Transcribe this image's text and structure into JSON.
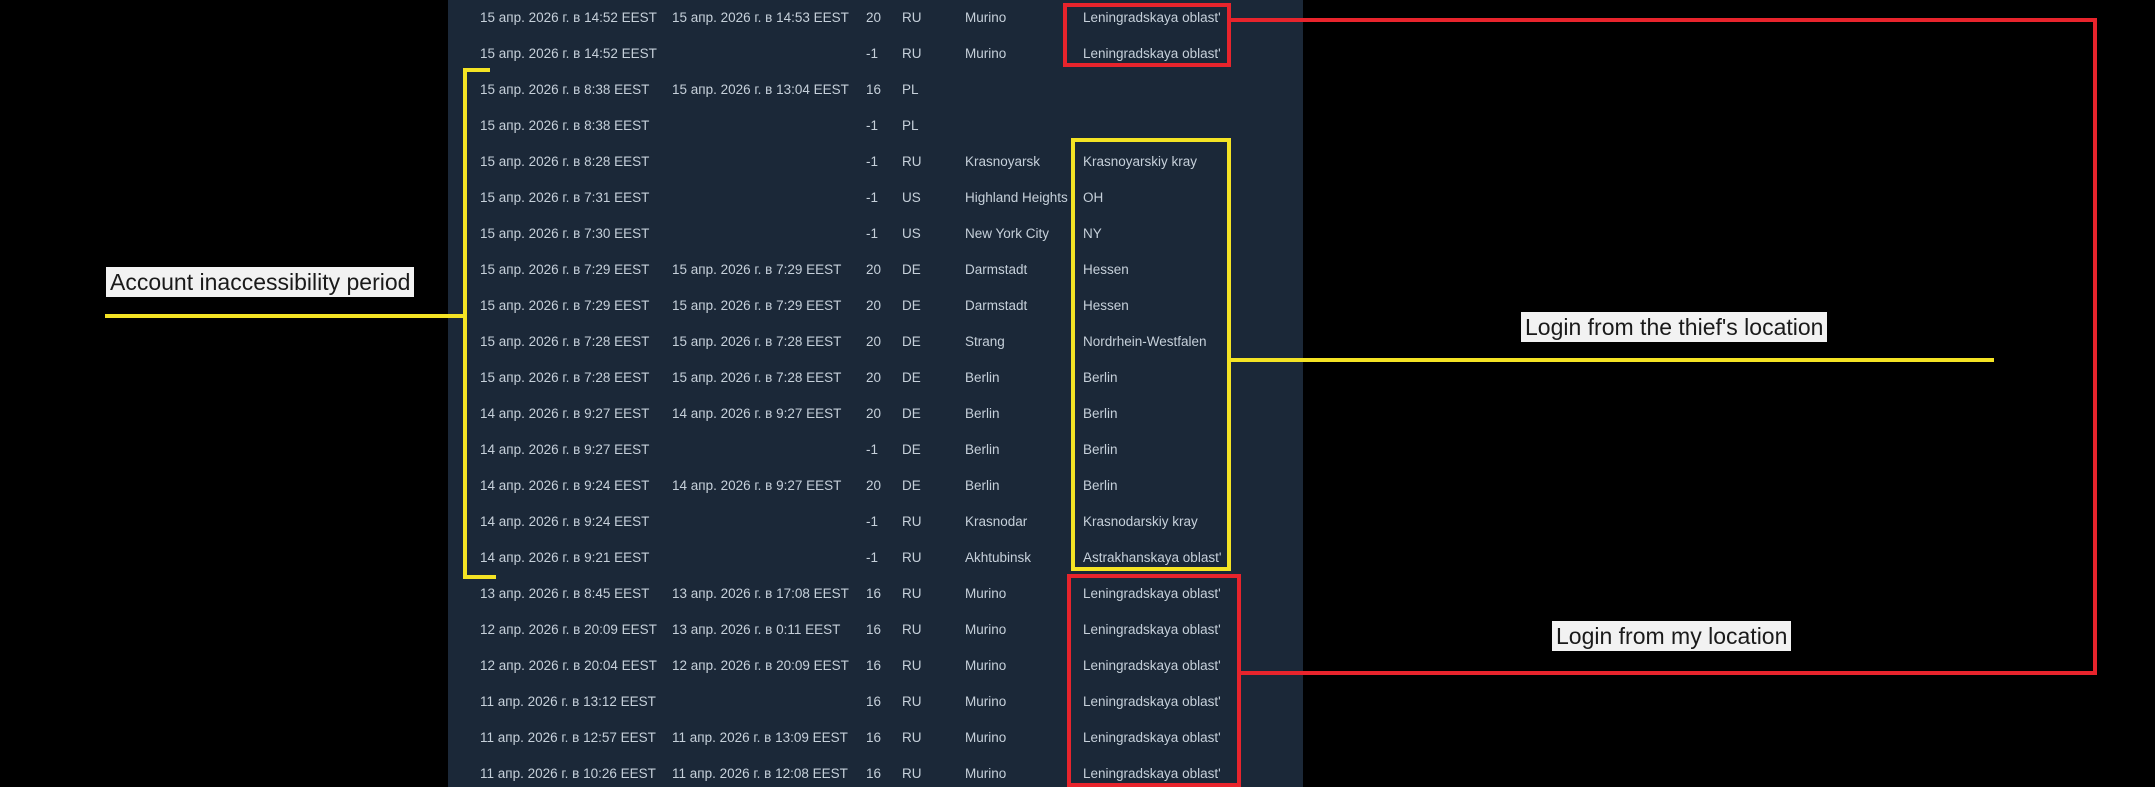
{
  "login_history": {
    "rows": [
      {
        "start": "15 апр. 2026 г. в 14:52 EEST",
        "end": "15 апр. 2026 г. в 14:53 EEST",
        "code": "20",
        "country": "RU",
        "city": "Murino",
        "region": "Leningradskaya oblast'"
      },
      {
        "start": "15 апр. 2026 г. в 14:52 EEST",
        "end": "",
        "code": "-1",
        "country": "RU",
        "city": "Murino",
        "region": "Leningradskaya oblast'"
      },
      {
        "start": "15 апр. 2026 г. в 8:38 EEST",
        "end": "15 апр. 2026 г. в 13:04 EEST",
        "code": "16",
        "country": "PL",
        "city": "",
        "region": ""
      },
      {
        "start": "15 апр. 2026 г. в 8:38 EEST",
        "end": "",
        "code": "-1",
        "country": "PL",
        "city": "",
        "region": ""
      },
      {
        "start": "15 апр. 2026 г. в 8:28 EEST",
        "end": "",
        "code": "-1",
        "country": "RU",
        "city": "Krasnoyarsk",
        "region": "Krasnoyarskiy kray"
      },
      {
        "start": "15 апр. 2026 г. в 7:31 EEST",
        "end": "",
        "code": "-1",
        "country": "US",
        "city": "Highland Heights",
        "region": "OH"
      },
      {
        "start": "15 апр. 2026 г. в 7:30 EEST",
        "end": "",
        "code": "-1",
        "country": "US",
        "city": "New York City",
        "region": "NY"
      },
      {
        "start": "15 апр. 2026 г. в 7:29 EEST",
        "end": "15 апр. 2026 г. в 7:29 EEST",
        "code": "20",
        "country": "DE",
        "city": "Darmstadt",
        "region": "Hessen"
      },
      {
        "start": "15 апр. 2026 г. в 7:29 EEST",
        "end": "15 апр. 2026 г. в 7:29 EEST",
        "code": "20",
        "country": "DE",
        "city": "Darmstadt",
        "region": "Hessen"
      },
      {
        "start": "15 апр. 2026 г. в 7:28 EEST",
        "end": "15 апр. 2026 г. в 7:28 EEST",
        "code": "20",
        "country": "DE",
        "city": "Strang",
        "region": "Nordrhein-Westfalen"
      },
      {
        "start": "15 апр. 2026 г. в 7:28 EEST",
        "end": "15 апр. 2026 г. в 7:28 EEST",
        "code": "20",
        "country": "DE",
        "city": "Berlin",
        "region": "Berlin"
      },
      {
        "start": "14 апр. 2026 г. в 9:27 EEST",
        "end": "14 апр. 2026 г. в 9:27 EEST",
        "code": "20",
        "country": "DE",
        "city": "Berlin",
        "region": "Berlin"
      },
      {
        "start": "14 апр. 2026 г. в 9:27 EEST",
        "end": "",
        "code": "-1",
        "country": "DE",
        "city": "Berlin",
        "region": "Berlin"
      },
      {
        "start": "14 апр. 2026 г. в 9:24 EEST",
        "end": "14 апр. 2026 г. в 9:27 EEST",
        "code": "20",
        "country": "DE",
        "city": "Berlin",
        "region": "Berlin"
      },
      {
        "start": "14 апр. 2026 г. в 9:24 EEST",
        "end": "",
        "code": "-1",
        "country": "RU",
        "city": "Krasnodar",
        "region": "Krasnodarskiy kray"
      },
      {
        "start": "14 апр. 2026 г. в 9:21 EEST",
        "end": "",
        "code": "-1",
        "country": "RU",
        "city": "Akhtubinsk",
        "region": "Astrakhanskaya oblast'"
      },
      {
        "start": "13 апр. 2026 г. в 8:45 EEST",
        "end": "13 апр. 2026 г. в 17:08 EEST",
        "code": "16",
        "country": "RU",
        "city": "Murino",
        "region": "Leningradskaya oblast'"
      },
      {
        "start": "12 апр. 2026 г. в 20:09 EEST",
        "end": "13 апр. 2026 г. в 0:11 EEST",
        "code": "16",
        "country": "RU",
        "city": "Murino",
        "region": "Leningradskaya oblast'"
      },
      {
        "start": "12 апр. 2026 г. в 20:04 EEST",
        "end": "12 апр. 2026 г. в 20:09 EEST",
        "code": "16",
        "country": "RU",
        "city": "Murino",
        "region": "Leningradskaya oblast'"
      },
      {
        "start": "11 апр. 2026 г. в 13:12 EEST",
        "end": "",
        "code": "16",
        "country": "RU",
        "city": "Murino",
        "region": "Leningradskaya oblast'"
      },
      {
        "start": "11 апр. 2026 г. в 12:57 EEST",
        "end": "11 апр. 2026 г. в 13:09 EEST",
        "code": "16",
        "country": "RU",
        "city": "Murino",
        "region": "Leningradskaya oblast'"
      },
      {
        "start": "11 апр. 2026 г. в 10:26 EEST",
        "end": "11 апр. 2026 г. в 12:08 EEST",
        "code": "16",
        "country": "RU",
        "city": "Murino",
        "region": "Leningradskaya oblast'"
      }
    ]
  },
  "annotations": {
    "inaccessibility_label": "Account inaccessibility period",
    "thief_label": "Login from the thief's location",
    "my_location_label": "Login from my location"
  },
  "colors": {
    "panel_background": "#1b2838",
    "text": "#c6d0da",
    "highlight_red": "#e8242c",
    "highlight_yellow": "#f4e324"
  }
}
